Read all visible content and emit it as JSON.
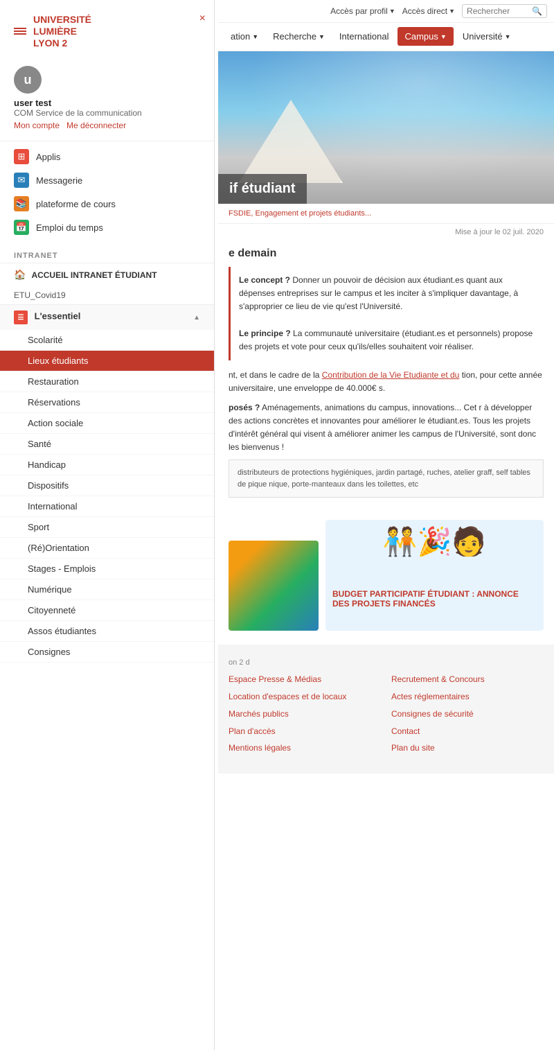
{
  "topbar": {
    "acces_profil": "Accès par profil",
    "acces_direct": "Accès direct",
    "rechercher": "Rechercher"
  },
  "sidebar": {
    "close_label": "×",
    "logo": {
      "line1": "UNIVERSITÉ",
      "line2": "LUMIÈRE",
      "line3": "LYON 2"
    },
    "user": {
      "initial": "u",
      "name": "user test",
      "department": "COM Service de la communication",
      "mon_compte": "Mon compte",
      "deconnexion": "Me déconnecter"
    },
    "app_links": [
      {
        "label": "Applis",
        "icon": "grid"
      },
      {
        "label": "Messagerie",
        "icon": "mail"
      },
      {
        "label": "plateforme de cours",
        "icon": "course"
      },
      {
        "label": "Emploi du temps",
        "icon": "calendar"
      }
    ],
    "intranet_label": "INTRANET",
    "accueil": "ACCUEIL INTRANET ÉTUDIANT",
    "etu_covid": "ETU_Covid19",
    "essentiel_label": "L'essentiel",
    "menu_items": [
      {
        "label": "Scolarité",
        "active": false
      },
      {
        "label": "Lieux étudiants",
        "active": true
      },
      {
        "label": "Restauration",
        "active": false
      },
      {
        "label": "Réservations",
        "active": false
      },
      {
        "label": "Action sociale",
        "active": false
      },
      {
        "label": "Santé",
        "active": false
      },
      {
        "label": "Handicap",
        "active": false
      },
      {
        "label": "Dispositifs",
        "active": false
      },
      {
        "label": "International",
        "active": false
      },
      {
        "label": "Sport",
        "active": false
      },
      {
        "label": "(Ré)Orientation",
        "active": false
      },
      {
        "label": "Stages - Emplois",
        "active": false
      },
      {
        "label": "Numérique",
        "active": false
      },
      {
        "label": "Citoyenneté",
        "active": false
      },
      {
        "label": "Assos étudiantes",
        "active": false
      },
      {
        "label": "Consignes",
        "active": false
      }
    ]
  },
  "nav": {
    "items": [
      {
        "label": "ation",
        "has_dropdown": true,
        "active": false
      },
      {
        "label": "Recherche",
        "has_dropdown": true,
        "active": false
      },
      {
        "label": "International",
        "has_dropdown": false,
        "active": false
      },
      {
        "label": "Campus",
        "has_dropdown": true,
        "active": true
      },
      {
        "label": "Université",
        "has_dropdown": true,
        "active": false
      }
    ]
  },
  "hero": {
    "title": "if étudiant"
  },
  "breadcrumb": "FSDIE, Engagement et projets étudiants...",
  "update_date": "Mise à jour le 02 juil. 2020",
  "content": {
    "title": "e demain",
    "concept_label": "Le concept ?",
    "concept_text": "Donner un pouvoir de décision aux étudiant.es quant aux dépenses entreprises sur le campus et les inciter à s'impliquer davantage, à s'approprier ce lieu de vie qu'est l'Université.",
    "principe_label": "Le principe ?",
    "principe_text": "La communauté universitaire (étudiant.es et personnels) propose des projets et vote pour ceux qu'ils/elles souhaitent voir réaliser.",
    "body_text1": "nt, et dans le cadre de la",
    "link_text": "Contribution de la Vie Etudiante et du",
    "body_text2": "tion, pour cette année universitaire, une enveloppe de 40.000€ s.",
    "proposes_label": "posés ?",
    "proposes_text": "Aménagements, animations du campus, innovations... Cet r à développer des actions concrètes et innovantes pour améliorer le étudiant.es. Tous les projets d'intérêt général qui visent à améliorer animer les campus de l'Université, sont donc les bienvenus !",
    "quote_text": "distributeurs de protections hygiéniques, jardin partagé, ruches, atelier graff, self tables de pique nique, porte-manteaux dans les toilettes, etc",
    "budget_label": "BUDGET PARTICIPATIF ÉTUDIANT : ANNONCE DES PROJETS FINANCÉS"
  },
  "footer": {
    "left_text": "on 2\nd",
    "col1": [
      {
        "label": "Espace Presse & Médias"
      },
      {
        "label": "Location d'espaces et de locaux"
      },
      {
        "label": "Marchés publics"
      },
      {
        "label": ""
      },
      {
        "label": "Plan d'accès"
      },
      {
        "label": "Mentions légales"
      }
    ],
    "col2": [
      {
        "label": "Recrutement & Concours"
      },
      {
        "label": "Actes réglementaires"
      },
      {
        "label": ""
      },
      {
        "label": "Consignes de sécurité"
      },
      {
        "label": "Contact"
      },
      {
        "label": "Plan du site"
      }
    ]
  }
}
